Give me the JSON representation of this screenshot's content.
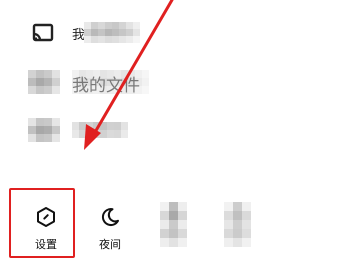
{
  "menu": {
    "rows": [
      {
        "label": "我",
        "icon": "cast-screen-icon",
        "blurred": true
      },
      {
        "label": "我的文件",
        "icon": "blurred-icon",
        "blurred": true
      },
      {
        "label": "",
        "icon": "blurred-icon",
        "blurred": true
      }
    ]
  },
  "bottom_bar": {
    "settings": {
      "label": "设置",
      "icon": "settings-hexagon-icon"
    },
    "night_mode": {
      "label": "夜间",
      "icon": "moon-icon"
    },
    "item3": {
      "label": "",
      "icon": "blurred-icon"
    },
    "item4": {
      "label": "",
      "icon": "blurred-icon"
    }
  },
  "annotation": {
    "highlight_color": "#e02020",
    "arrow_color": "#e02020"
  }
}
